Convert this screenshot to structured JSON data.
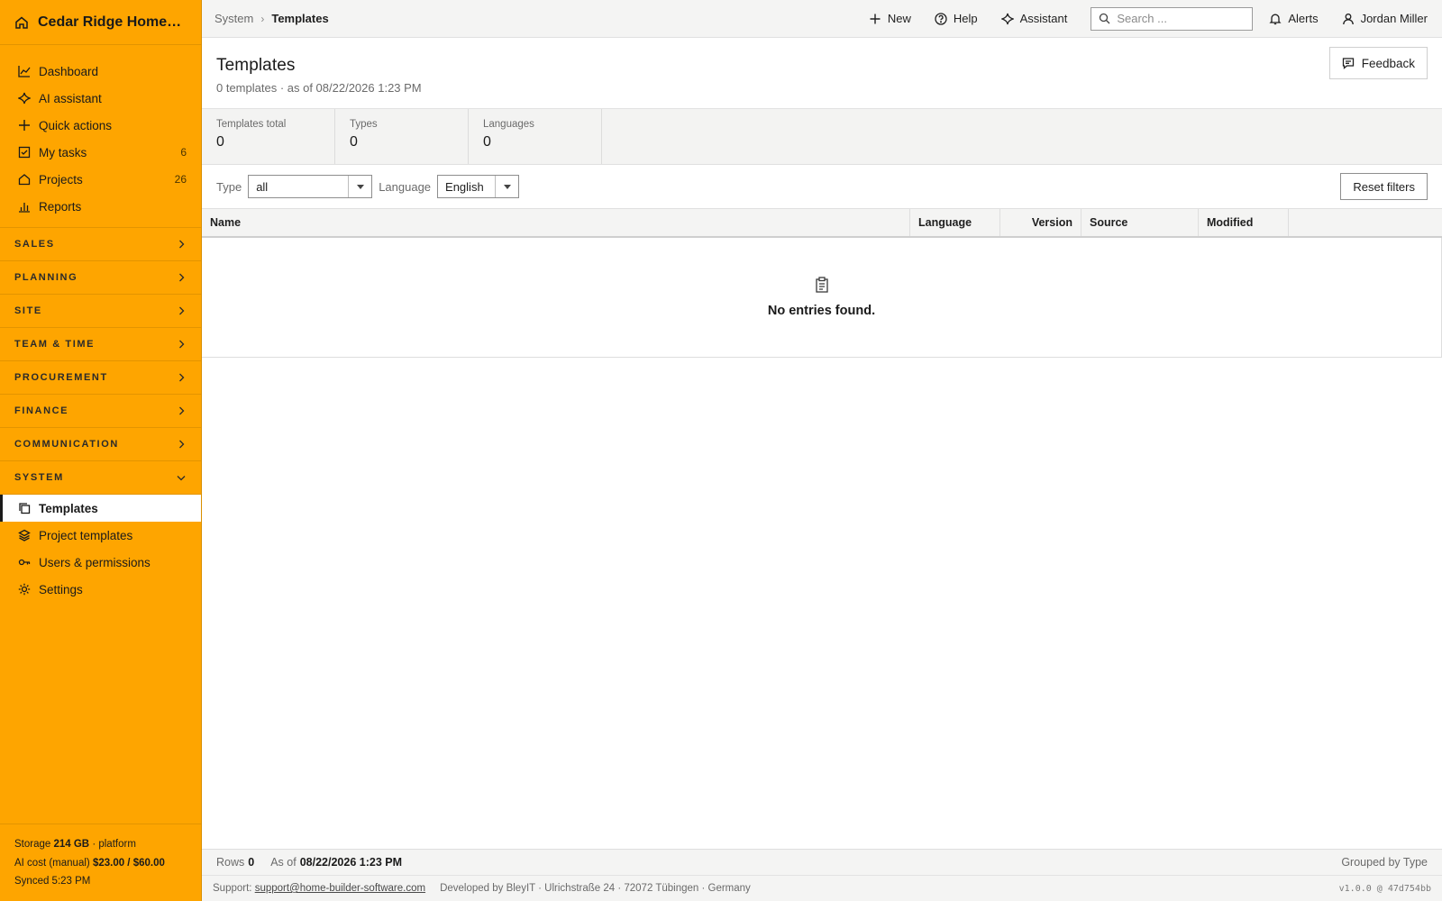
{
  "app": {
    "brand": "Cedar Ridge Homes L…"
  },
  "sidebar": {
    "top_items": [
      {
        "label": "Dashboard",
        "icon": "chart-line-icon"
      },
      {
        "label": "AI assistant",
        "icon": "sparkle-icon"
      },
      {
        "label": "Quick actions",
        "icon": "plus-icon"
      },
      {
        "label": "My tasks",
        "icon": "checkbox-icon",
        "count": "6"
      },
      {
        "label": "Projects",
        "icon": "home-icon",
        "count": "26"
      },
      {
        "label": "Reports",
        "icon": "bar-chart-icon"
      }
    ],
    "sections": [
      "SALES",
      "PLANNING",
      "SITE",
      "TEAM & TIME",
      "PROCUREMENT",
      "FINANCE",
      "COMMUNICATION"
    ],
    "expanded_section": "SYSTEM",
    "system_items": [
      {
        "label": "Templates",
        "icon": "copy-icon",
        "active": true
      },
      {
        "label": "Project templates",
        "icon": "layers-icon"
      },
      {
        "label": "Users & permissions",
        "icon": "key-icon"
      },
      {
        "label": "Settings",
        "icon": "gear-icon"
      }
    ],
    "footer": {
      "storage_label": "Storage",
      "storage_value": "214 GB",
      "storage_suffix": "· platform",
      "ai_cost_label": "AI cost (manual)",
      "ai_cost_value": "$23.00 / $60.00",
      "synced": "Synced 5:23 PM"
    }
  },
  "topbar": {
    "breadcrumb_parent": "System",
    "breadcrumb_current": "Templates",
    "new_label": "New",
    "help_label": "Help",
    "assistant_label": "Assistant",
    "search_placeholder": "Search ...",
    "alerts_label": "Alerts",
    "user_name": "Jordan Miller"
  },
  "page": {
    "title": "Templates",
    "subtitle": "0 templates · as of 08/22/2026 1:23 PM",
    "feedback_label": "Feedback"
  },
  "stats": [
    {
      "label": "Templates total",
      "value": "0"
    },
    {
      "label": "Types",
      "value": "0"
    },
    {
      "label": "Languages",
      "value": "0"
    }
  ],
  "filters": {
    "type_label": "Type",
    "type_value": "all",
    "language_label": "Language",
    "language_value": "English",
    "reset_label": "Reset filters"
  },
  "table": {
    "columns": [
      "Name",
      "Language",
      "Version",
      "Source",
      "Modified"
    ],
    "empty_text": "No entries found."
  },
  "statusbar": {
    "rows_label": "Rows",
    "rows_value": "0",
    "asof_label": "As of",
    "asof_value": "08/22/2026 1:23 PM",
    "grouping": "Grouped by Type"
  },
  "footer": {
    "support_label": "Support:",
    "support_email": "support@home-builder-software.com",
    "developer": "Developed by BleyIT · Ulrichstraße 24 · 72072 Tübingen · Germany",
    "version": "v1.0.0 @ 47d754bb"
  },
  "colors": {
    "sidebar": "#fea500",
    "active_bg": "#ffffff",
    "text": "#1f1f1f"
  }
}
